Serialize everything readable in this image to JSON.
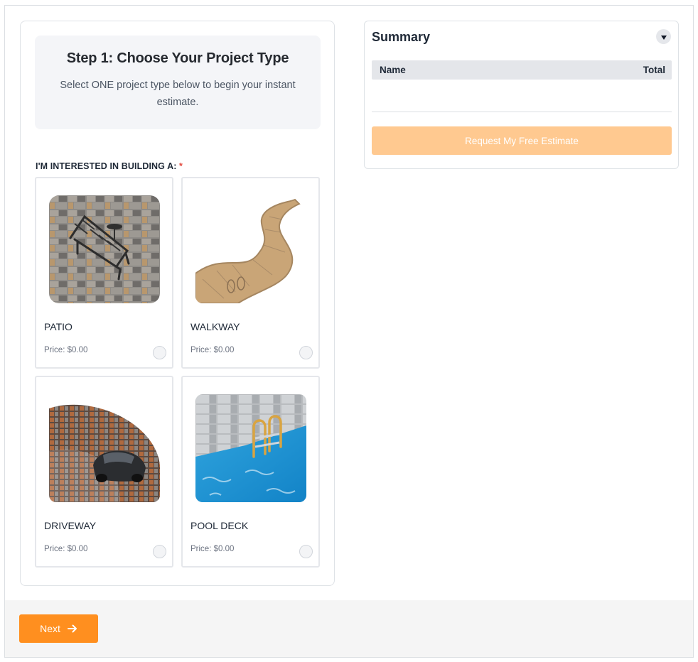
{
  "step": {
    "title": "Step 1: Choose Your Project Type",
    "subtitle": "Select ONE project type below to begin your instant estimate."
  },
  "field": {
    "label": "I'M INTERESTED IN BUILDING A:",
    "required_mark": "*"
  },
  "options": [
    {
      "title": "PATIO",
      "price": "Price: $0.00",
      "icon": "patio-image"
    },
    {
      "title": "WALKWAY",
      "price": "Price: $0.00",
      "icon": "walkway-image"
    },
    {
      "title": "DRIVEWAY",
      "price": "Price: $0.00",
      "icon": "driveway-image"
    },
    {
      "title": "POOL DECK",
      "price": "Price: $0.00",
      "icon": "pool-deck-image"
    }
  ],
  "summary": {
    "title": "Summary",
    "columns": [
      "Name",
      "Total"
    ],
    "request_button": "Request My Free Estimate"
  },
  "footer": {
    "next_label": "Next"
  },
  "colors": {
    "accent": "#ff8f1f",
    "accent_disabled": "#ffc990",
    "required": "#e2483d"
  }
}
